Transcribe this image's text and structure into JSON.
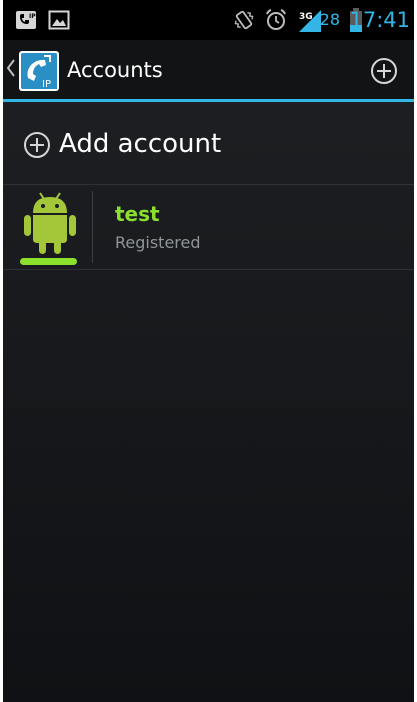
{
  "status_bar": {
    "left_icons": [
      "sip-notification-icon",
      "image-icon"
    ],
    "right_icons": [
      "vibrate-icon",
      "alarm-icon",
      "signal-3g-icon",
      "battery-icon"
    ],
    "network_type": "3G",
    "battery_level": "28",
    "time": "17:41"
  },
  "action_bar": {
    "title": "Accounts",
    "accent_color": "#33b5e5",
    "app_icon_label": "IP"
  },
  "add_account": {
    "label": "Add account"
  },
  "accounts": [
    {
      "name": "test",
      "status": "Registered",
      "status_color": "#8ae02d",
      "icon": "android-icon"
    }
  ]
}
